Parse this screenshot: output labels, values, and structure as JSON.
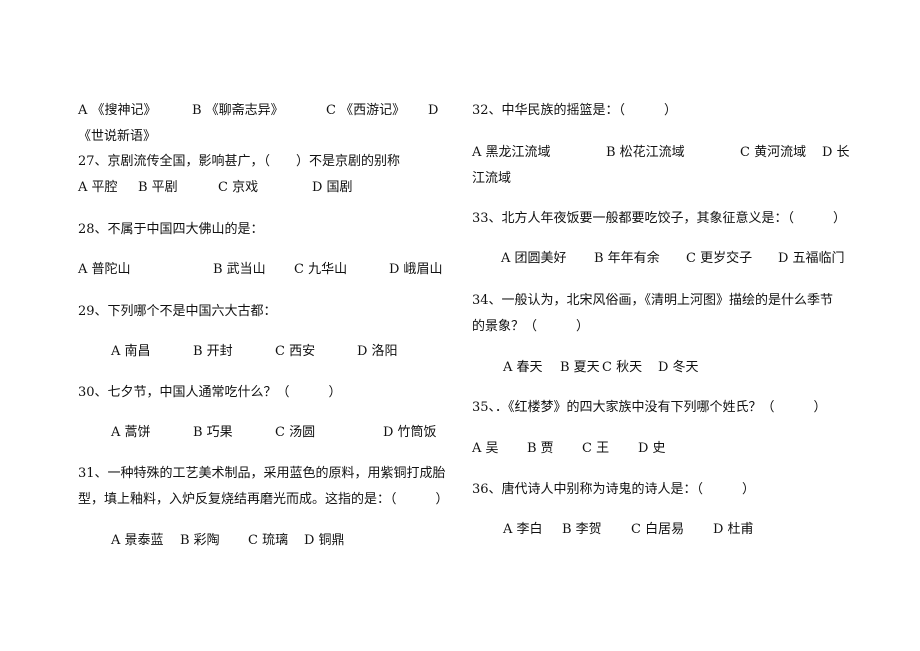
{
  "left_column": {
    "q26": {
      "options": [
        "A 《搜神记》",
        "B 《聊斋志异》",
        "C 《西游记》",
        "D"
      ],
      "wrap": "《世说新语》"
    },
    "q27": {
      "question": "27、京剧流传全国，影响甚广，（　　）不是京剧的别称",
      "options": [
        "A 平腔",
        "B 平剧",
        "C 京戏",
        "D 国剧"
      ]
    },
    "q28": {
      "question": "28、不属于中国四大佛山的是：",
      "options": [
        "A 普陀山",
        "B 武当山",
        "C 九华山",
        "D 峨眉山"
      ]
    },
    "q29": {
      "question": "29、下列哪个不是中国六大古都：",
      "options": [
        "A 南昌",
        "B 开封",
        "C 西安",
        "D 洛阳"
      ]
    },
    "q30": {
      "question": "30、七夕节，中国人通常吃什么？（　　　）",
      "options": [
        "A 蒿饼",
        "B 巧果",
        "C 汤圆",
        "D 竹筒饭"
      ]
    },
    "q31": {
      "question_line1": "31、一种特殊的工艺美术制品，采用蓝色的原料，用紫铜打成胎",
      "question_line2": "型，填上釉料，入炉反复烧结再磨光而成。这指的是：（　　　）",
      "options": [
        "A 景泰蓝",
        "B 彩陶",
        "C 琉璃",
        "D 铜鼎"
      ]
    }
  },
  "right_column": {
    "q32": {
      "question": "32、中华民族的摇篮是：（　　　）",
      "options": [
        "A 黑龙江流域",
        "B 松花江流域",
        "C 黄河流域",
        "D 长"
      ],
      "wrap": "江流域"
    },
    "q33": {
      "question": "33、北方人年夜饭要一般都要吃饺子，其象征意义是：（　　　）",
      "options": [
        "A 团圆美好",
        "B 年年有余",
        "C 更岁交子",
        "D 五福临门"
      ]
    },
    "q34": {
      "question_line1": "34、一般认为，北宋风俗画，《清明上河图》描绘的是什么季节",
      "question_line2": "的景象？（　　　）",
      "options": [
        "A 春天",
        "B 夏天",
        "C 秋天",
        "D 冬天"
      ]
    },
    "q35": {
      "question": "35、．《红楼梦》的四大家族中没有下列哪个姓氏？（　　　）",
      "options": [
        "A 吴",
        "B 贾",
        "C 王",
        "D 史"
      ]
    },
    "q36": {
      "question": "36、唐代诗人中别称为诗鬼的诗人是：（　　　）",
      "options": [
        "A 李白",
        "B 李贺",
        "C 白居易",
        "D 杜甫"
      ]
    }
  }
}
